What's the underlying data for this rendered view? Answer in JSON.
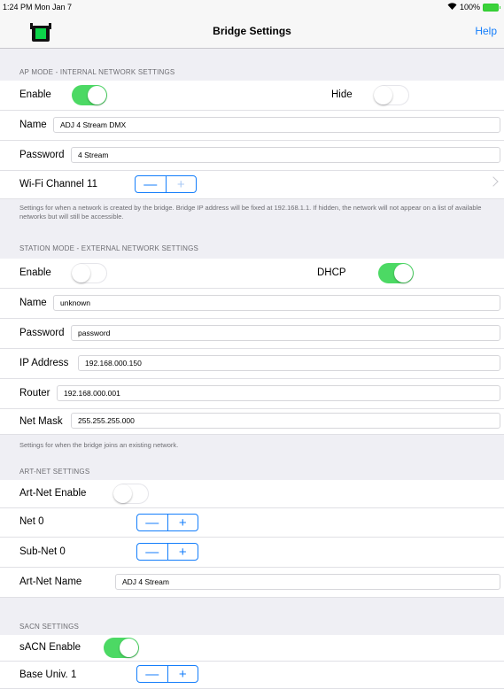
{
  "status_bar": {
    "time": "1:24 PM  Mon Jan 7",
    "battery": "100%"
  },
  "nav": {
    "title": "Bridge Settings",
    "help_label": "Help"
  },
  "colors": {
    "accent": "#147efb",
    "switch_on": "#4cd964",
    "logo_light": "#0cd44a"
  },
  "ap_mode": {
    "header": "AP MODE - INTERNAL NETWORK SETTINGS",
    "enable_label": "Enable",
    "enable_on": true,
    "hide_label": "Hide",
    "hide_on": false,
    "name_label": "Name",
    "name_value": "ADJ 4 Stream DMX",
    "password_label": "Password",
    "password_value": "4 Stream",
    "channel_label": "Wi-Fi Channel 11",
    "footer": "Settings for when a network is created by the bridge. Bridge IP address will be fixed at 192.168.1.1. If hidden, the network will not appear on a list of available networks but will still be accessible."
  },
  "station_mode": {
    "header": "STATION MODE - EXTERNAL NETWORK SETTINGS",
    "enable_label": "Enable",
    "enable_on": false,
    "dhcp_label": "DHCP",
    "dhcp_on": true,
    "name_label": "Name",
    "name_value": "unknown",
    "password_label": "Password",
    "password_value": "password",
    "ip_label": "IP Address",
    "ip_value": "192.168.000.150",
    "router_label": "Router",
    "router_value": "192.168.000.001",
    "netmask_label": "Net Mask",
    "netmask_value": "255.255.255.000",
    "footer": "Settings for when the bridge joins an existing network."
  },
  "artnet": {
    "header": "ART-NET SETTINGS",
    "enable_label": "Art-Net Enable",
    "enable_on": false,
    "net_label": "Net 0",
    "subnet_label": "Sub-Net 0",
    "name_label": "Art-Net Name",
    "name_value": "ADJ 4 Stream"
  },
  "sacn": {
    "header": "SACN SETTINGS",
    "enable_label": "sACN Enable",
    "enable_on": true,
    "base_univ_label": "Base Univ. 1"
  },
  "stepper": {
    "minus": "—",
    "plus": "+"
  }
}
